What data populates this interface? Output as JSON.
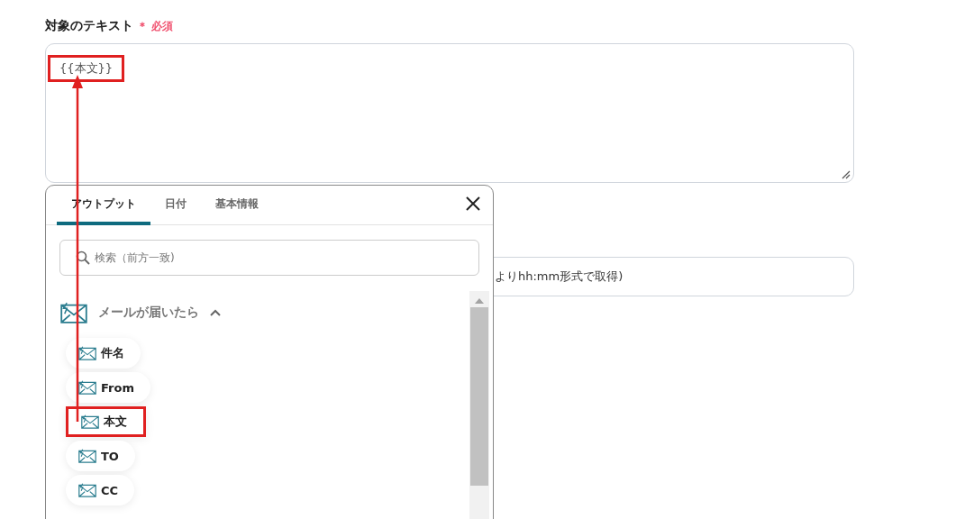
{
  "field": {
    "label": "対象のテキスト",
    "required_mark": "＊",
    "required_text": "必須",
    "token": "{{本文}}",
    "token_highlighted": true
  },
  "second_field": {
    "value": "よりhh:mm形式で取得)"
  },
  "popup": {
    "tabs": [
      {
        "label": "アウトプット",
        "selected": true
      },
      {
        "label": "日付",
        "selected": false
      },
      {
        "label": "基本情報",
        "selected": false
      }
    ],
    "search": {
      "placeholder": "検索（前方一致)"
    },
    "section": {
      "title": "メールが届いたら",
      "expanded": true,
      "items": [
        {
          "label": "件名",
          "highlighted": false
        },
        {
          "label": "From",
          "highlighted": false
        },
        {
          "label": "本文",
          "highlighted": true
        },
        {
          "label": "TO",
          "highlighted": false
        },
        {
          "label": "CC",
          "highlighted": false
        }
      ]
    }
  },
  "annotation": {
    "arrow": true
  }
}
